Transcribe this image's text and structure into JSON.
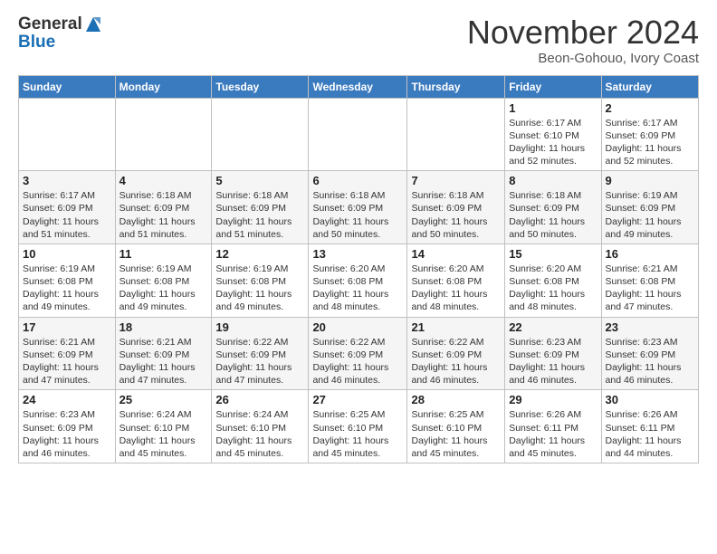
{
  "header": {
    "logo_line1": "General",
    "logo_line2": "Blue",
    "month": "November 2024",
    "location": "Beon-Gohouo, Ivory Coast"
  },
  "weekdays": [
    "Sunday",
    "Monday",
    "Tuesday",
    "Wednesday",
    "Thursday",
    "Friday",
    "Saturday"
  ],
  "weeks": [
    [
      {
        "day": "",
        "info": ""
      },
      {
        "day": "",
        "info": ""
      },
      {
        "day": "",
        "info": ""
      },
      {
        "day": "",
        "info": ""
      },
      {
        "day": "",
        "info": ""
      },
      {
        "day": "1",
        "info": "Sunrise: 6:17 AM\nSunset: 6:10 PM\nDaylight: 11 hours\nand 52 minutes."
      },
      {
        "day": "2",
        "info": "Sunrise: 6:17 AM\nSunset: 6:09 PM\nDaylight: 11 hours\nand 52 minutes."
      }
    ],
    [
      {
        "day": "3",
        "info": "Sunrise: 6:17 AM\nSunset: 6:09 PM\nDaylight: 11 hours\nand 51 minutes."
      },
      {
        "day": "4",
        "info": "Sunrise: 6:18 AM\nSunset: 6:09 PM\nDaylight: 11 hours\nand 51 minutes."
      },
      {
        "day": "5",
        "info": "Sunrise: 6:18 AM\nSunset: 6:09 PM\nDaylight: 11 hours\nand 51 minutes."
      },
      {
        "day": "6",
        "info": "Sunrise: 6:18 AM\nSunset: 6:09 PM\nDaylight: 11 hours\nand 50 minutes."
      },
      {
        "day": "7",
        "info": "Sunrise: 6:18 AM\nSunset: 6:09 PM\nDaylight: 11 hours\nand 50 minutes."
      },
      {
        "day": "8",
        "info": "Sunrise: 6:18 AM\nSunset: 6:09 PM\nDaylight: 11 hours\nand 50 minutes."
      },
      {
        "day": "9",
        "info": "Sunrise: 6:19 AM\nSunset: 6:09 PM\nDaylight: 11 hours\nand 49 minutes."
      }
    ],
    [
      {
        "day": "10",
        "info": "Sunrise: 6:19 AM\nSunset: 6:08 PM\nDaylight: 11 hours\nand 49 minutes."
      },
      {
        "day": "11",
        "info": "Sunrise: 6:19 AM\nSunset: 6:08 PM\nDaylight: 11 hours\nand 49 minutes."
      },
      {
        "day": "12",
        "info": "Sunrise: 6:19 AM\nSunset: 6:08 PM\nDaylight: 11 hours\nand 49 minutes."
      },
      {
        "day": "13",
        "info": "Sunrise: 6:20 AM\nSunset: 6:08 PM\nDaylight: 11 hours\nand 48 minutes."
      },
      {
        "day": "14",
        "info": "Sunrise: 6:20 AM\nSunset: 6:08 PM\nDaylight: 11 hours\nand 48 minutes."
      },
      {
        "day": "15",
        "info": "Sunrise: 6:20 AM\nSunset: 6:08 PM\nDaylight: 11 hours\nand 48 minutes."
      },
      {
        "day": "16",
        "info": "Sunrise: 6:21 AM\nSunset: 6:08 PM\nDaylight: 11 hours\nand 47 minutes."
      }
    ],
    [
      {
        "day": "17",
        "info": "Sunrise: 6:21 AM\nSunset: 6:09 PM\nDaylight: 11 hours\nand 47 minutes."
      },
      {
        "day": "18",
        "info": "Sunrise: 6:21 AM\nSunset: 6:09 PM\nDaylight: 11 hours\nand 47 minutes."
      },
      {
        "day": "19",
        "info": "Sunrise: 6:22 AM\nSunset: 6:09 PM\nDaylight: 11 hours\nand 47 minutes."
      },
      {
        "day": "20",
        "info": "Sunrise: 6:22 AM\nSunset: 6:09 PM\nDaylight: 11 hours\nand 46 minutes."
      },
      {
        "day": "21",
        "info": "Sunrise: 6:22 AM\nSunset: 6:09 PM\nDaylight: 11 hours\nand 46 minutes."
      },
      {
        "day": "22",
        "info": "Sunrise: 6:23 AM\nSunset: 6:09 PM\nDaylight: 11 hours\nand 46 minutes."
      },
      {
        "day": "23",
        "info": "Sunrise: 6:23 AM\nSunset: 6:09 PM\nDaylight: 11 hours\nand 46 minutes."
      }
    ],
    [
      {
        "day": "24",
        "info": "Sunrise: 6:23 AM\nSunset: 6:09 PM\nDaylight: 11 hours\nand 46 minutes."
      },
      {
        "day": "25",
        "info": "Sunrise: 6:24 AM\nSunset: 6:10 PM\nDaylight: 11 hours\nand 45 minutes."
      },
      {
        "day": "26",
        "info": "Sunrise: 6:24 AM\nSunset: 6:10 PM\nDaylight: 11 hours\nand 45 minutes."
      },
      {
        "day": "27",
        "info": "Sunrise: 6:25 AM\nSunset: 6:10 PM\nDaylight: 11 hours\nand 45 minutes."
      },
      {
        "day": "28",
        "info": "Sunrise: 6:25 AM\nSunset: 6:10 PM\nDaylight: 11 hours\nand 45 minutes."
      },
      {
        "day": "29",
        "info": "Sunrise: 6:26 AM\nSunset: 6:11 PM\nDaylight: 11 hours\nand 45 minutes."
      },
      {
        "day": "30",
        "info": "Sunrise: 6:26 AM\nSunset: 6:11 PM\nDaylight: 11 hours\nand 44 minutes."
      }
    ]
  ]
}
